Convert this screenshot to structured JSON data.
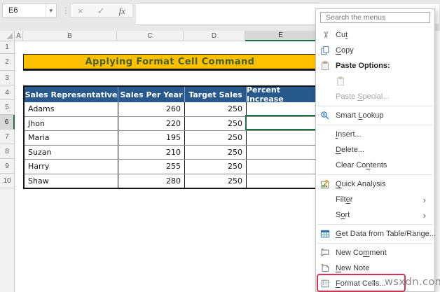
{
  "app": {
    "name_box_value": "E6",
    "name_box_caret": "chevron-down-icon",
    "formula_buttons": [
      {
        "icon": "cancel-icon",
        "glyph": "×"
      },
      {
        "icon": "confirm-icon",
        "glyph": "✓"
      },
      {
        "icon": "function-icon",
        "glyph": "fx"
      }
    ],
    "formula_bar_value": ""
  },
  "sheet": {
    "column_headers": [
      "A",
      "B",
      "C",
      "D",
      "E"
    ],
    "row_headers": [
      "1",
      "2",
      "3",
      "4",
      "5",
      "6",
      "7",
      "8",
      "9",
      "10"
    ],
    "selected_cell": "E6",
    "selected_column": "E",
    "selected_row": "6",
    "banner": {
      "text": "Applying Format Cell Command",
      "bg": "#FFC000",
      "text_color": "#44622A"
    },
    "table": {
      "header_bg": "#27598C",
      "headers": [
        "Sales Representative",
        "Sales Per Year",
        "Target Sales",
        "Percent Increase"
      ],
      "rows": [
        {
          "name": "Adams",
          "sales_per_year": "260",
          "target_sales": "250",
          "percent_increase": ""
        },
        {
          "name": "Jhon",
          "sales_per_year": "220",
          "target_sales": "250",
          "percent_increase": ""
        },
        {
          "name": "Maria",
          "sales_per_year": "195",
          "target_sales": "250",
          "percent_increase": ""
        },
        {
          "name": "Suzan",
          "sales_per_year": "210",
          "target_sales": "250",
          "percent_increase": ""
        },
        {
          "name": "Harry",
          "sales_per_year": "255",
          "target_sales": "250",
          "percent_increase": ""
        },
        {
          "name": "Shaw",
          "sales_per_year": "280",
          "target_sales": "250",
          "percent_increase": ""
        }
      ]
    }
  },
  "menu": {
    "search_placeholder": "Search the menus",
    "highlight_color": "#D23350",
    "selection_color": "#1E7145",
    "items": [
      {
        "type": "item",
        "icon": "cut-icon",
        "label": "Cut",
        "u": "t"
      },
      {
        "type": "item",
        "icon": "copy-icon",
        "label": "Copy",
        "u": "C"
      },
      {
        "type": "item",
        "icon": "paste-icon",
        "label": "Paste Options:",
        "bold": true
      },
      {
        "type": "paste-thumb",
        "icon": "paste-icon"
      },
      {
        "type": "item",
        "label": "Paste Special...",
        "u": "S",
        "disabled": true
      },
      {
        "type": "sep"
      },
      {
        "type": "item",
        "icon": "smart-lookup-icon",
        "label": "Smart Lookup",
        "u": "L"
      },
      {
        "type": "sep"
      },
      {
        "type": "item",
        "label": "Insert...",
        "u": "I"
      },
      {
        "type": "item",
        "label": "Delete...",
        "u": "D"
      },
      {
        "type": "item",
        "label": "Clear Contents",
        "u": "n"
      },
      {
        "type": "sep"
      },
      {
        "type": "item",
        "icon": "quick-analysis-icon",
        "label": "Quick Analysis",
        "u": "Q"
      },
      {
        "type": "item",
        "label": "Filter",
        "u": "e",
        "chevron": true
      },
      {
        "type": "item",
        "label": "Sort",
        "u": "o",
        "chevron": true
      },
      {
        "type": "sep"
      },
      {
        "type": "item",
        "icon": "get-data-icon",
        "label": "Get Data from Table/Range...",
        "u": "G"
      },
      {
        "type": "sep"
      },
      {
        "type": "item",
        "icon": "new-comment-icon",
        "label": "New Comment",
        "u": "m"
      },
      {
        "type": "item",
        "icon": "new-note-icon",
        "label": "New Note",
        "u": "N"
      },
      {
        "type": "item",
        "icon": "format-cells-icon",
        "label": "Format Cells...",
        "u": "F",
        "highlighted": true
      }
    ]
  },
  "watermark": "wsxdn.com"
}
